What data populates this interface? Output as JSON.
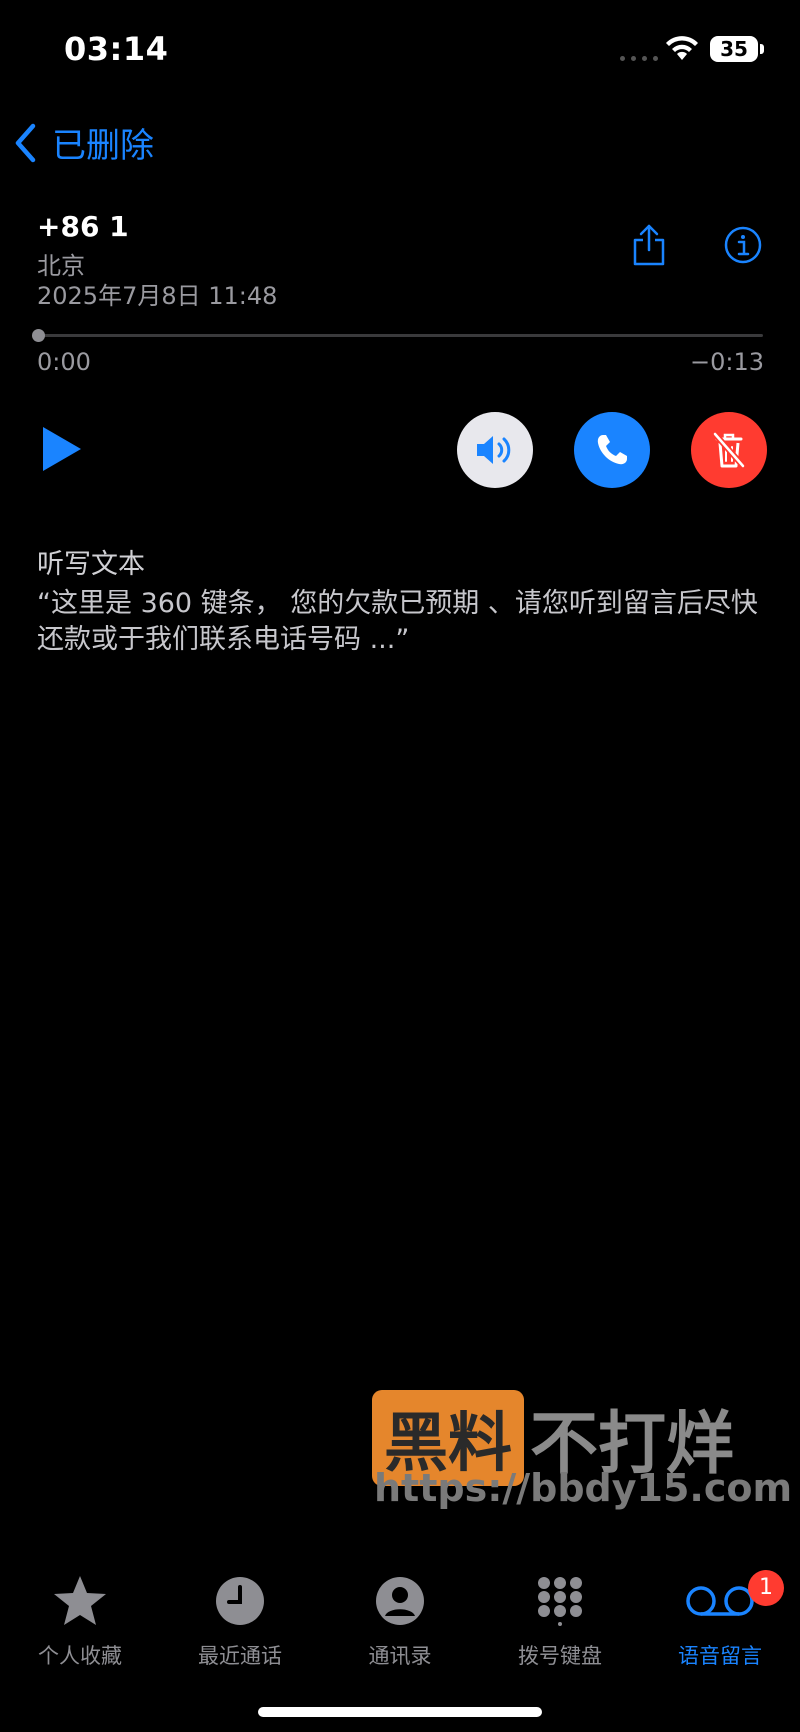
{
  "status_bar": {
    "time": "03:14",
    "battery": "35"
  },
  "nav": {
    "back_label": "已删除"
  },
  "voicemail": {
    "number": "+86 1",
    "location": "北京",
    "date": "2025年7月8日 11:48",
    "elapsed": "0:00",
    "remaining": "−0:13",
    "progress": 0
  },
  "transcript": {
    "title": "听写文本",
    "text": "“这里是 360 键条， 您的欠款已预期 、请您听到留言后尽快还款或于我们联系电话号码 ...”"
  },
  "watermark": {
    "box": "黑料",
    "text": "不打烊",
    "url": "https://bbdy15.com"
  },
  "tabs": [
    {
      "label": "个人收藏",
      "icon": "star-icon"
    },
    {
      "label": "最近通话",
      "icon": "clock-icon"
    },
    {
      "label": "通讯录",
      "icon": "person-icon"
    },
    {
      "label": "拨号键盘",
      "icon": "keypad-icon"
    },
    {
      "label": "语音留言",
      "icon": "voicemail-icon",
      "active": true,
      "badge": "1"
    }
  ],
  "colors": {
    "accent": "#1a84ff",
    "danger": "#ff3b30",
    "background": "#000000"
  }
}
